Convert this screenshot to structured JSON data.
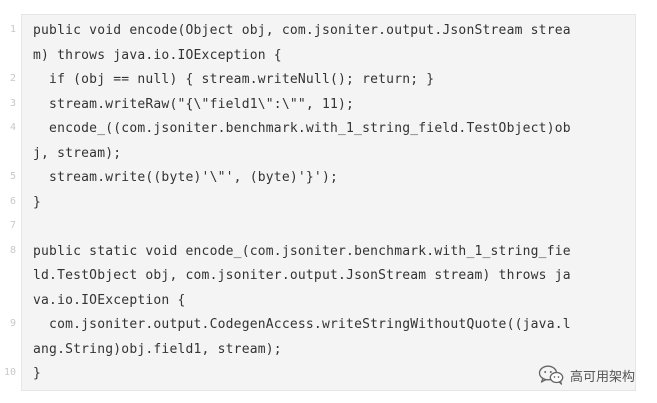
{
  "code": {
    "line_numbers": [
      "1",
      "2",
      "3",
      "4",
      "5",
      "6",
      "7",
      "8",
      "9",
      "10"
    ],
    "lines": [
      "public void encode(Object obj, com.jsoniter.output.JsonStream strea",
      "m) throws java.io.IOException {",
      "  if (obj == null) { stream.writeNull(); return; }",
      "  stream.writeRaw(\"{\\\"field1\\\":\\\"\", 11);",
      "  encode_((com.jsoniter.benchmark.with_1_string_field.TestObject)ob",
      "j, stream);",
      "  stream.write((byte)'\\\"', (byte)'}');",
      "}",
      "",
      "public static void encode_(com.jsoniter.benchmark.with_1_string_fie",
      "ld.TestObject obj, com.jsoniter.output.JsonStream stream) throws ja",
      "va.io.IOException {",
      "  com.jsoniter.output.CodegenAccess.writeStringWithoutQuote((java.l",
      "ang.String)obj.field1, stream);",
      "}"
    ]
  },
  "watermark": {
    "icon": "wechat-icon",
    "text": "高可用架构"
  },
  "colors": {
    "code_background": "#f4f4f4",
    "code_text": "#333333",
    "line_number": "#c8c8c8"
  }
}
